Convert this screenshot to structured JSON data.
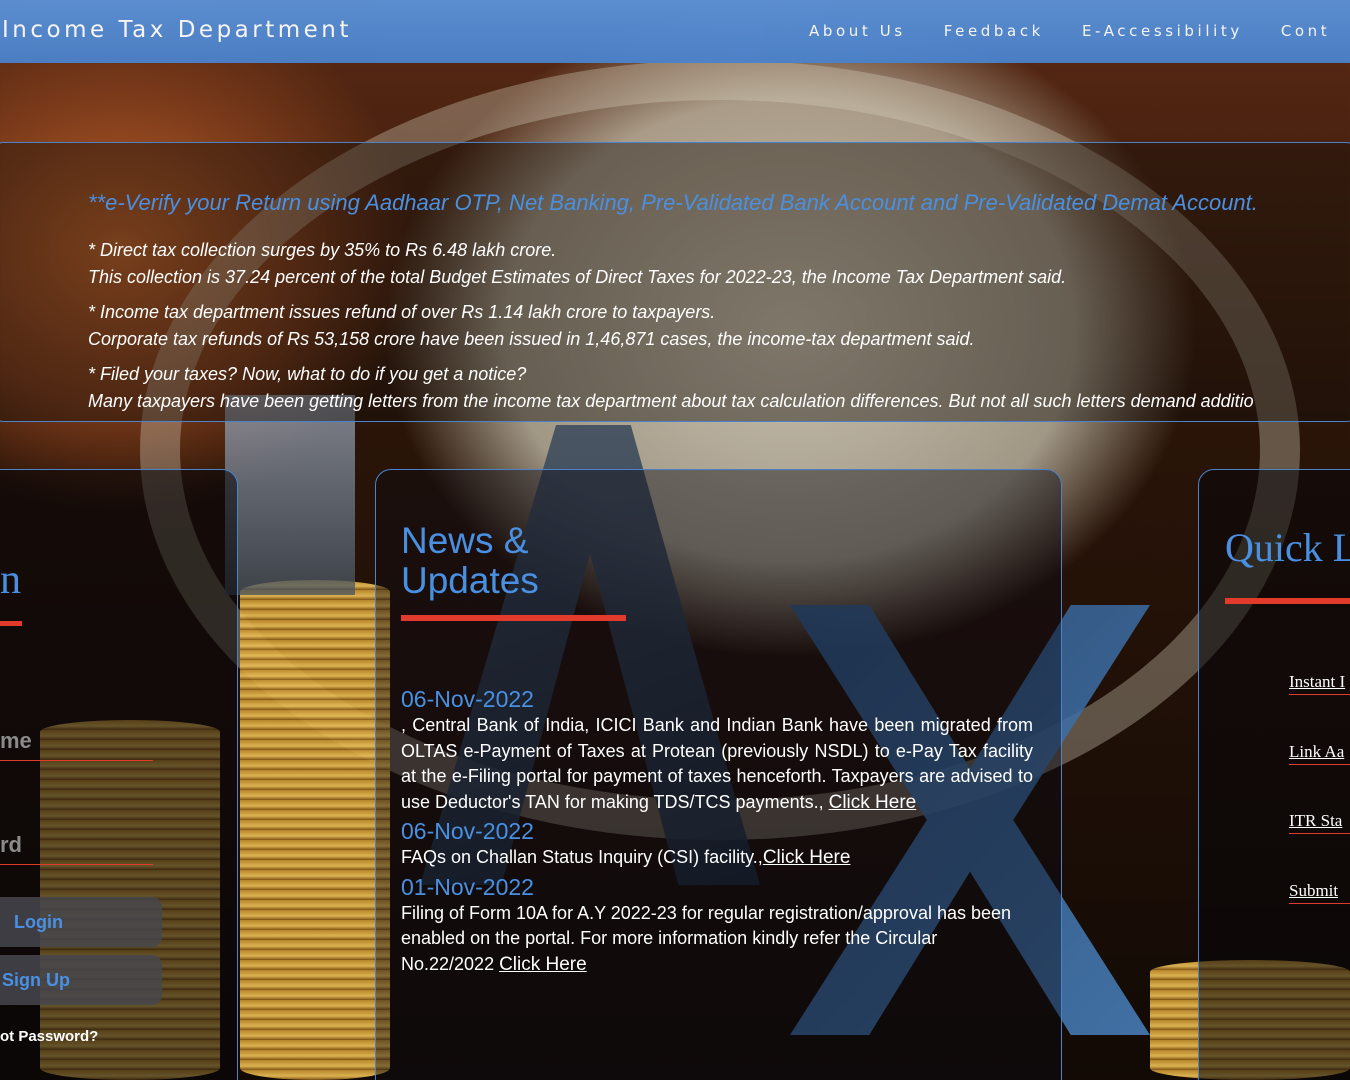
{
  "header": {
    "brand": "Income Tax Department",
    "nav": [
      "About Us",
      "Feedback",
      "E-Accessibility",
      "Cont"
    ]
  },
  "ticker": {
    "headline": "**e-Verify your Return using Aadhaar OTP, Net Banking, Pre-Validated Bank Account and Pre-Validated Demat Account.",
    "items": [
      {
        "title": "* Direct tax collection surges by 35% to Rs 6.48 lakh crore.",
        "body": "This collection is 37.24 percent of the total Budget Estimates of Direct Taxes for 2022-23, the Income Tax Department said."
      },
      {
        "title": "* Income tax department issues refund of over Rs 1.14 lakh crore to taxpayers.",
        "body": "Corporate tax refunds of Rs 53,158 crore have been issued in 1,46,871 cases, the income-tax department said."
      },
      {
        "title": "* Filed your taxes? Now, what to do if you get a notice?",
        "body": "Many taxpayers have been getting letters from the income tax department about tax calculation differences. But not all such letters demand additio"
      }
    ]
  },
  "login": {
    "title": "n",
    "username_label": "me",
    "password_label": "rd",
    "login_button": "Login",
    "signup_button": "Sign Up",
    "forgot": "ot Password?"
  },
  "news": {
    "title_line1": "News &",
    "title_line2": "Updates",
    "items": [
      {
        "date": "06-Nov-2022",
        "text": ", Central Bank of India, ICICI Bank and Indian Bank have been migrated from OLTAS e-Payment of Taxes at Protean (previously NSDL) to e-Pay Tax facility at the e-Filing portal for payment of taxes henceforth. Taxpayers are advised to use Deductor's TAN for making TDS/TCS payments., ",
        "link": "Click Here"
      },
      {
        "date": "06-Nov-2022",
        "text": "FAQs on Challan Status Inquiry (CSI) facility.,",
        "link": "Click Here"
      },
      {
        "date": "01-Nov-2022",
        "text": "Filing of Form 10A for A.Y 2022-23 for regular registration/approval has been enabled on the portal. For more information kindly refer the Circular No.22/2022 ",
        "link": "Click Here"
      }
    ]
  },
  "quick_links": {
    "title": "Quick L",
    "links": [
      "Instant I",
      "Link Aa",
      "ITR Sta",
      "Submit "
    ]
  },
  "colors": {
    "accent_blue": "#4a90e2",
    "accent_red": "#e33b2b",
    "header_blue": "#4a82cc"
  }
}
